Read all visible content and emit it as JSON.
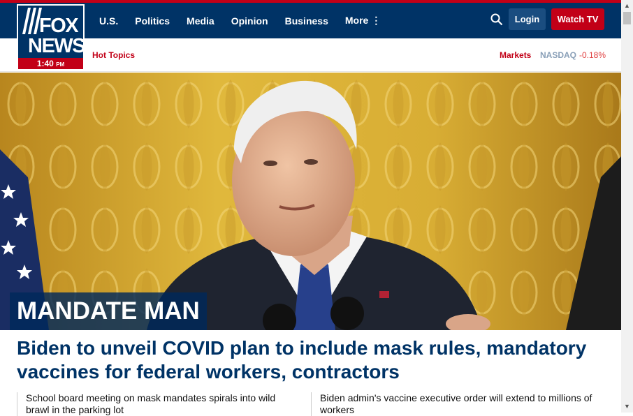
{
  "logo": {
    "line1": "FOX",
    "line2": "NEWS",
    "time": "1:40",
    "ampm": "PM"
  },
  "nav": {
    "items": [
      "U.S.",
      "Politics",
      "Media",
      "Opinion",
      "Business",
      "More"
    ],
    "login_label": "Login",
    "watch_label": "Watch TV",
    "search_icon": "search-icon",
    "more_icon": "vertical-dots-icon"
  },
  "subnav": {
    "hot_topics": "Hot Topics",
    "markets_label": "Markets",
    "index_name": "NASDAQ",
    "index_change": "-0.18%"
  },
  "hero": {
    "kicker": "MANDATE MAN",
    "headline": "Biden to unveil COVID plan to include mask rules, mandatory vaccines for federal workers, contractors"
  },
  "stories": [
    "School board meeting on mask mandates spirals into wild brawl in the parking lot",
    "Biden admin's vaccine executive order will extend to millions of workers"
  ],
  "colors": {
    "navy": "#003366",
    "red": "#c20017",
    "negative": "#e04040"
  }
}
